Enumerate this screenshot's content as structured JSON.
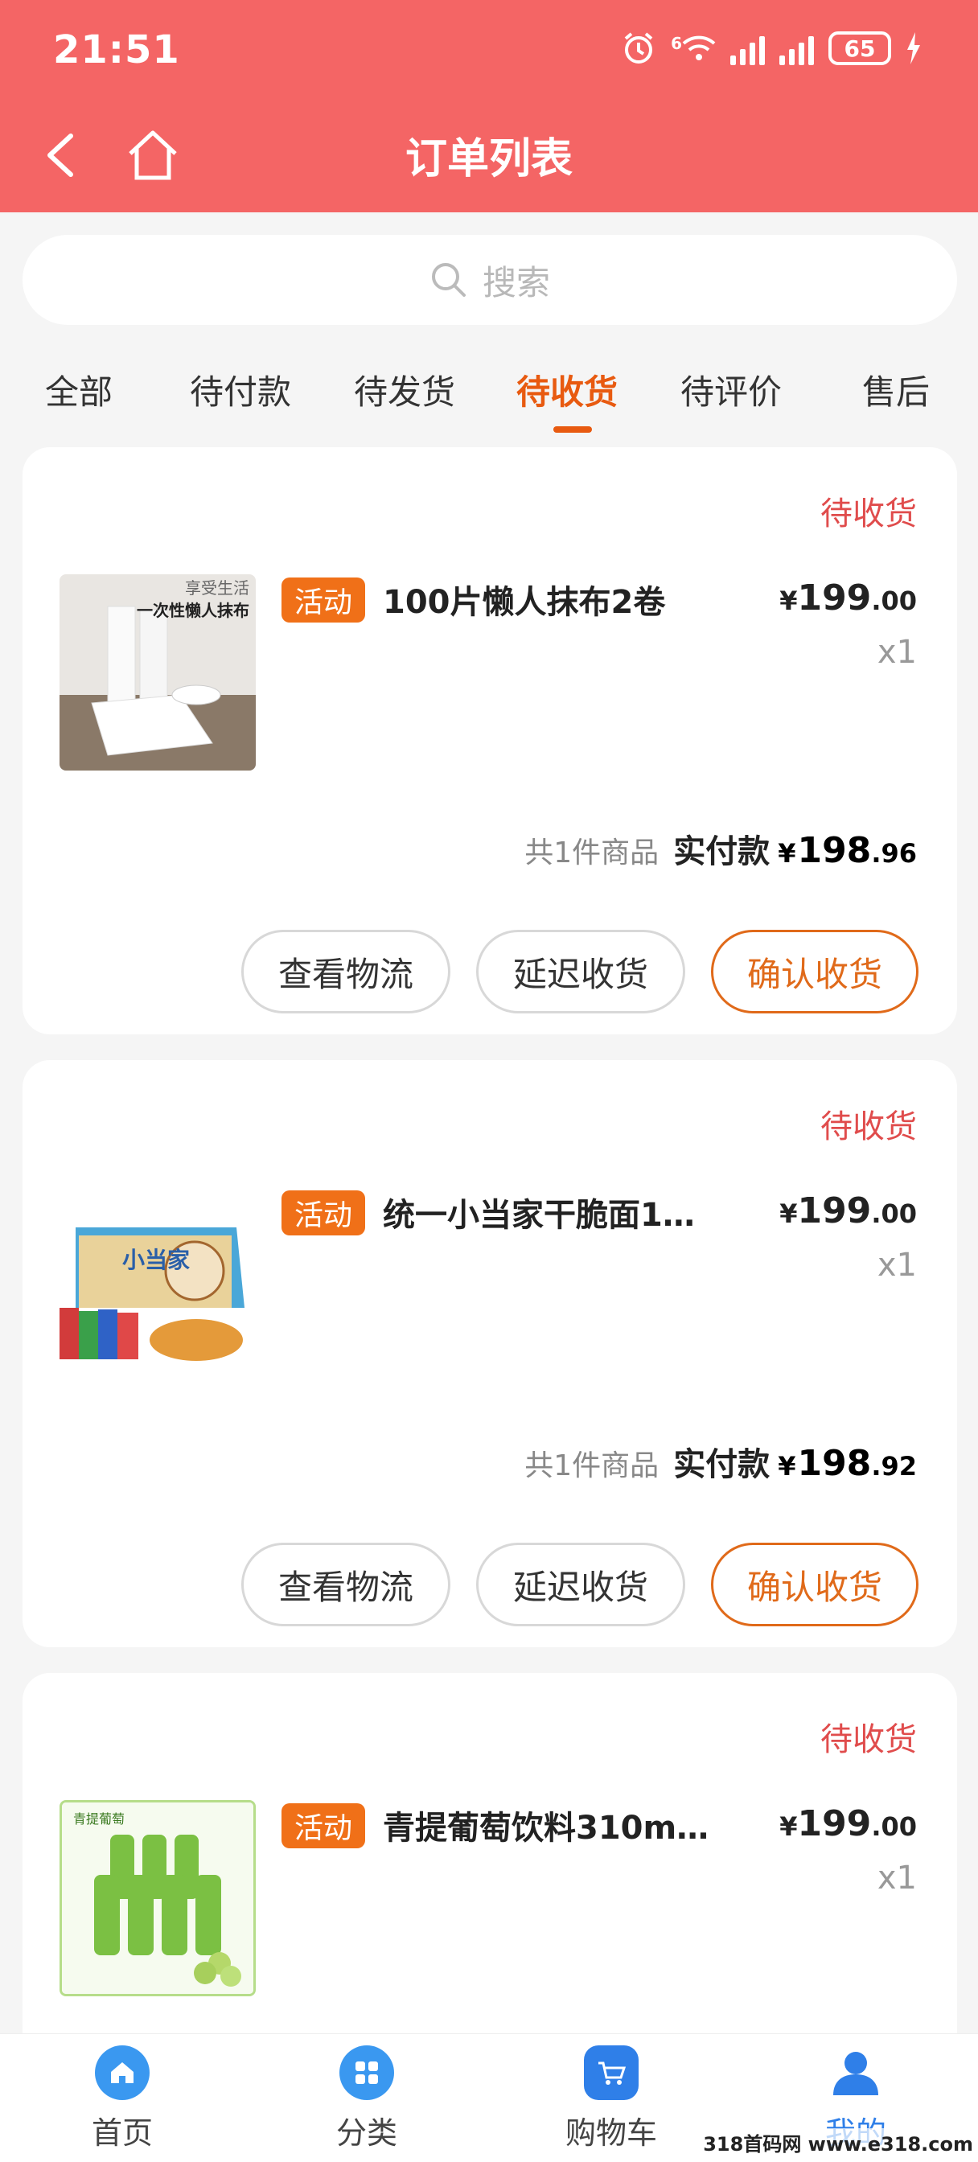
{
  "status_bar": {
    "time": "21:51",
    "network": "6",
    "battery": "65"
  },
  "header": {
    "title": "订单列表"
  },
  "search": {
    "placeholder": "搜索"
  },
  "tabs": [
    {
      "label": "全部",
      "active": false
    },
    {
      "label": "待付款",
      "active": false
    },
    {
      "label": "待发货",
      "active": false
    },
    {
      "label": "待收货",
      "active": true
    },
    {
      "label": "待评价",
      "active": false
    },
    {
      "label": "售后",
      "active": false
    }
  ],
  "orders": [
    {
      "status": "待收货",
      "tag": "活动",
      "name": "100片懒人抹布2卷",
      "price_symbol": "¥",
      "price_int": "199",
      "price_dec": ".00",
      "qty": "x1",
      "count_text": "共1件商品",
      "paid_label": "实付款",
      "paid_symbol": "¥",
      "paid_int": "198",
      "paid_dec": ".96",
      "thumb_text_1": "享受生活",
      "thumb_text_2": "一次性懒人抹布",
      "buttons": {
        "logistics": "查看物流",
        "delay": "延迟收货",
        "confirm": "确认收货"
      }
    },
    {
      "status": "待收货",
      "tag": "活动",
      "name": "统一小当家干脆面1…",
      "price_symbol": "¥",
      "price_int": "199",
      "price_dec": ".00",
      "qty": "x1",
      "count_text": "共1件商品",
      "paid_label": "实付款",
      "paid_symbol": "¥",
      "paid_int": "198",
      "paid_dec": ".92",
      "thumb_text_1": "小当家",
      "buttons": {
        "logistics": "查看物流",
        "delay": "延迟收货",
        "confirm": "确认收货"
      }
    },
    {
      "status": "待收货",
      "tag": "活动",
      "name": "青提葡萄饮料310m…",
      "price_symbol": "¥",
      "price_int": "199",
      "price_dec": ".00",
      "qty": "x1",
      "thumb_text_1": "青提葡萄"
    }
  ],
  "bottom_nav": [
    {
      "label": "首页",
      "icon": "home-icon",
      "color": "#2b8ff0"
    },
    {
      "label": "分类",
      "icon": "grid-icon",
      "color": "#2b8ff0"
    },
    {
      "label": "购物车",
      "icon": "cart-icon",
      "color": "#2b8ff0"
    },
    {
      "label": "我的",
      "icon": "user-icon",
      "color": "#2b8ff0"
    }
  ],
  "watermark": "318首码网 www.e318.com",
  "colors": {
    "header": "#f46565",
    "accent": "#e85a10",
    "status_text": "#e04c4c",
    "tag": "#f07018"
  }
}
